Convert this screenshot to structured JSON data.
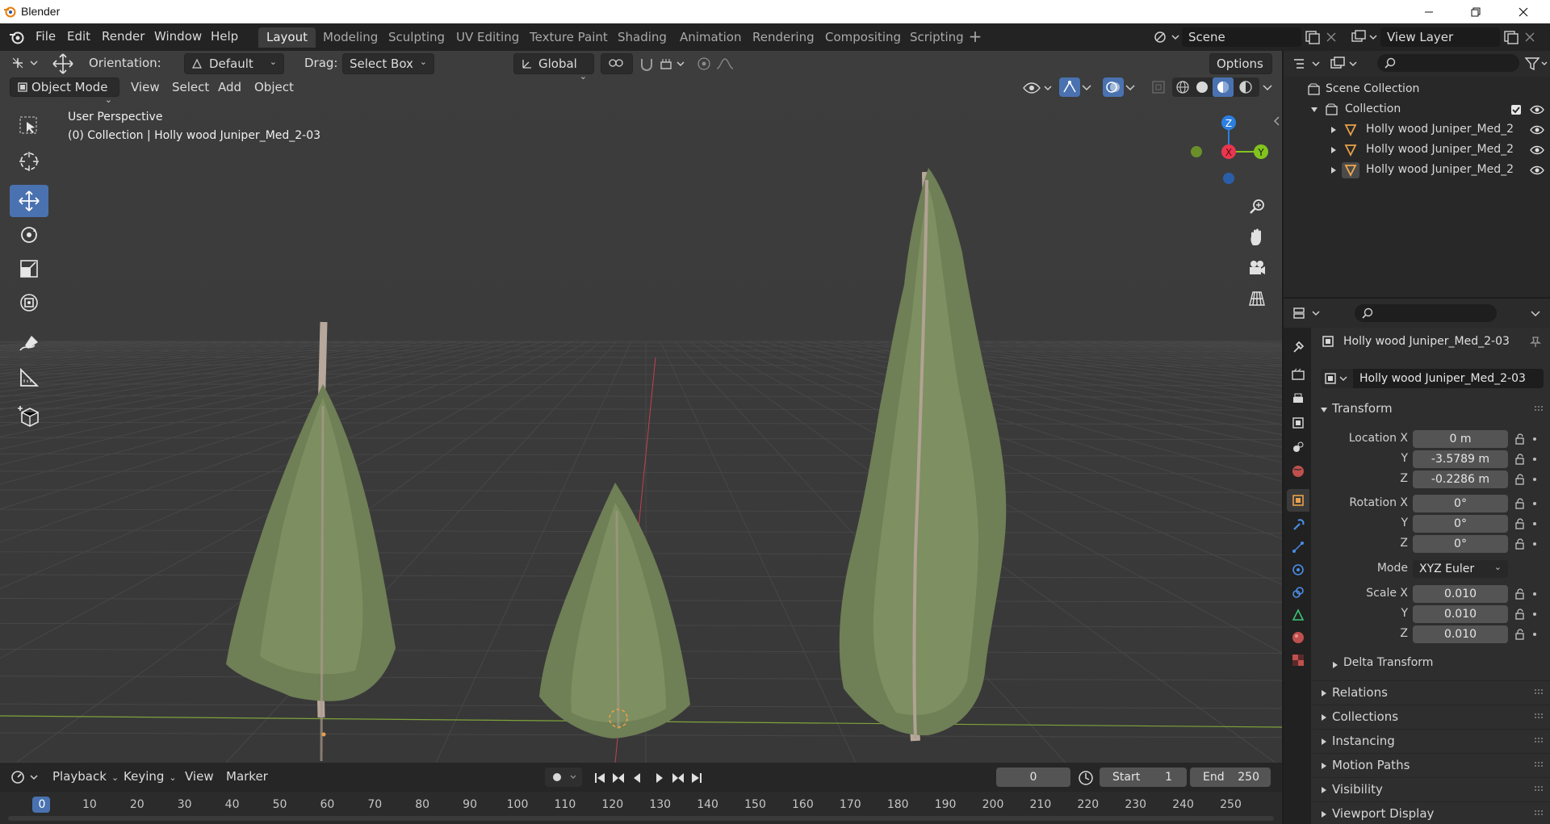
{
  "window": {
    "title": "Blender"
  },
  "menu": [
    "File",
    "Edit",
    "Render",
    "Window",
    "Help"
  ],
  "workspaces": [
    "Layout",
    "Modeling",
    "Sculpting",
    "UV Editing",
    "Texture Paint",
    "Shading",
    "Animation",
    "Rendering",
    "Compositing",
    "Scripting"
  ],
  "scene": {
    "name": "Scene",
    "view_layer": "View Layer"
  },
  "tool_header": {
    "orientation_label": "Orientation:",
    "orientation_value": "Default",
    "drag_label": "Drag:",
    "drag_value": "Select Box",
    "transform_orientation": "Global",
    "options_label": "Options"
  },
  "viewport_header": {
    "mode": "Object Mode",
    "menus": [
      "View",
      "Select",
      "Add",
      "Object"
    ]
  },
  "viewport_info": {
    "perspective": "User Perspective",
    "collection_line": "(0) Collection | Holly wood Juniper_Med_2-03"
  },
  "gizmo": {
    "z": "Z",
    "y": "Y",
    "x": "X"
  },
  "outliner": {
    "scene_collection": "Scene Collection",
    "collection": "Collection",
    "objects": [
      "Holly wood Juniper_Med_2",
      "Holly wood Juniper_Med_2",
      "Holly wood Juniper_Med_2"
    ]
  },
  "properties": {
    "object_name": "Holly wood Juniper_Med_2-03",
    "object_field": "Holly wood Juniper_Med_2-03",
    "transform_title": "Transform",
    "location_label": "Location X",
    "rotation_label": "Rotation X",
    "scale_label": "Scale X",
    "mode_label": "Mode",
    "mode_value": "XYZ Euler",
    "axis_y": "Y",
    "axis_z": "Z",
    "location": [
      "0 m",
      "-3.5789 m",
      "-0.2286 m"
    ],
    "rotation": [
      "0°",
      "0°",
      "0°"
    ],
    "scale": [
      "0.010",
      "0.010",
      "0.010"
    ],
    "delta_transform": "Delta Transform",
    "sections": [
      "Relations",
      "Collections",
      "Instancing",
      "Motion Paths",
      "Visibility",
      "Viewport Display"
    ]
  },
  "timeline": {
    "menus": [
      "Playback",
      "Keying",
      "View",
      "Marker"
    ],
    "current_frame": "0",
    "start_label": "Start",
    "start_value": "1",
    "end_label": "End",
    "end_value": "250",
    "ruler": [
      "0",
      "10",
      "20",
      "30",
      "40",
      "50",
      "60",
      "70",
      "80",
      "90",
      "100",
      "110",
      "120",
      "130",
      "140",
      "150",
      "160",
      "170",
      "180",
      "190",
      "200",
      "210",
      "220",
      "230",
      "240",
      "250"
    ]
  },
  "colors": {
    "accent_blue": "#4a72b0",
    "axis_x": "#e8374f",
    "axis_y": "#82c41e",
    "axis_z": "#2b7fe0",
    "foliage": "#73835a",
    "trunk": "#b8aa9e",
    "active_orange": "#e8a04a"
  }
}
